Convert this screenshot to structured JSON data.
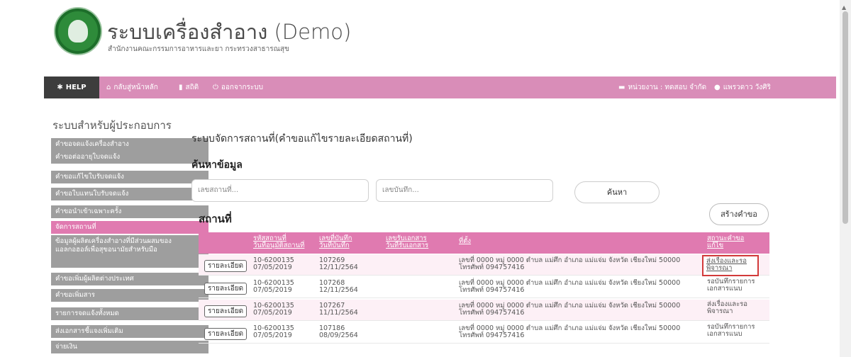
{
  "header": {
    "title": "ระบบเครื่องสำอาง (Demo)",
    "subtitle": "สำนักงานคณะกรรมการอาหารและยา กระทรวงสาธารณสุข"
  },
  "nav": {
    "help": "HELP",
    "home": "กลับสู่หน้าหลัก",
    "stats": "สถิติ",
    "logout": "ออกจากระบบ",
    "agency": "หน่วยงาน : ทดสอบ จำกัด",
    "user": "แพรวดาว วังศิริ"
  },
  "sidebar": {
    "title": "ระบบสำหรับผู้ประกอบการ",
    "items": [
      {
        "label": "คำขอจดแจ้งเครื่องสำอาง"
      },
      {
        "label": "คำขอต่ออายุใบจดแจ้ง"
      },
      {
        "label": "คำขอแก้ไขใบรับจดแจ้ง"
      },
      {
        "label": "คำขอใบแทนใบรับจดแจ้ง"
      },
      {
        "label": "คำขอนำเข้าเฉพาะครั้ง"
      },
      {
        "label": "จัดการสถานที่"
      },
      {
        "label": "ข้อมูลผู้ผลิตเครื่องสำอางที่มีส่วนผสมของแอลกอฮอล์เพื่อสุขอนามัยสำหรับมือ"
      },
      {
        "label": "คำขอเพิ่มผู้ผลิตต่างประเทศ"
      },
      {
        "label": "คำขอเพิ่มสาร"
      },
      {
        "label": "รายการจดแจ้งทั้งหมด"
      },
      {
        "label": "ส่งเอกสารชี้แจงเพิ่มเติม"
      },
      {
        "label": "จ่ายเงิน"
      }
    ]
  },
  "main": {
    "title": "ระบบจัดการสถานที่(คำขอแก้ไขรายละเอียดสถานที่)",
    "search_title": "ค้นหาข้อมูล",
    "place_no_placeholder": "เลขสถานที่...",
    "record_no_placeholder": "เลขบันทึก...",
    "search_button": "ค้นหา",
    "places_title": "สถานที่",
    "create_button": "สร้างคำขอ"
  },
  "table": {
    "headers": {
      "code_line1": "รหัสสถานที่",
      "code_line2": "วันที่อนุมัติสถานที่",
      "rec_line1": "เลขที่บันทึก",
      "rec_line2": "วันที่บันทึก",
      "doc_line1": "เลขรับเอกสาร",
      "doc_line2": "วันที่รับเอกสาร",
      "addr": "ที่ตั้ง",
      "status_line1": "สถานะคำขอ",
      "status_line2": "แก้ไข"
    },
    "detail_label": "รายละเอียด",
    "rows": [
      {
        "code": "10-6200135",
        "approved": "07/05/2019",
        "rec_no": "107269",
        "rec_date": "12/11/2564",
        "addr1": "เลขที่ 0000 หมู่ 0000 ตำบล แม่ศึก อำเภอ แม่แจ่ม จังหวัด เชียงใหม่ 50000",
        "addr2": "โทรศัพท์ 094757416",
        "status": "ส่งเรื่องและรอพิจารณา"
      },
      {
        "code": "10-6200135",
        "approved": "07/05/2019",
        "rec_no": "107268",
        "rec_date": "12/11/2564",
        "addr1": "เลขที่ 0000 หมู่ 0000 ตำบล แม่ศึก อำเภอ แม่แจ่ม จังหวัด เชียงใหม่ 50000",
        "addr2": "โทรศัพท์ 094757416",
        "status": "รอบันทึกรายการเอกสารแนบ"
      },
      {
        "code": "10-6200135",
        "approved": "07/05/2019",
        "rec_no": "107267",
        "rec_date": "11/11/2564",
        "addr1": "เลขที่ 0000 หมู่ 0000 ตำบล แม่ศึก อำเภอ แม่แจ่ม จังหวัด เชียงใหม่ 50000",
        "addr2": "โทรศัพท์ 094757416",
        "status": "ส่งเรื่องและรอพิจารณา"
      },
      {
        "code": "10-6200135",
        "approved": "07/05/2019",
        "rec_no": "107186",
        "rec_date": "08/09/2564",
        "addr1": "เลขที่ 0000 หมู่ 0000 ตำบล แม่ศึก อำเภอ แม่แจ่ม จังหวัด เชียงใหม่ 50000",
        "addr2": "โทรศัพท์ 094757416",
        "status": "รอบันทึกรายการเอกสารแนบ"
      }
    ]
  },
  "colors": {
    "nav_bg": "#d98db8",
    "accent_pink": "#e07ab0",
    "help_bg": "#3d3d3d",
    "menu_grey": "#9e9e9e",
    "highlight_border": "#d23a3a"
  }
}
